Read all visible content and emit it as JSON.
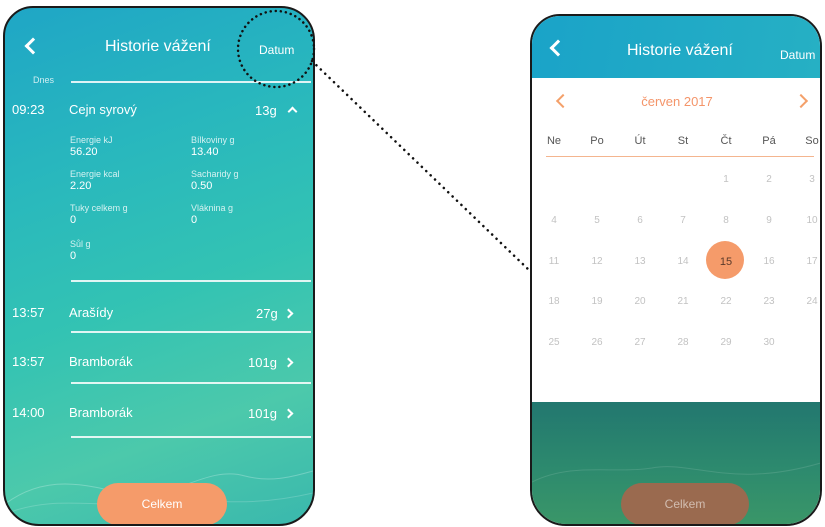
{
  "left": {
    "header": {
      "title": "Historie vážení",
      "date_button": "Datum"
    },
    "section_label": "Dnes",
    "entries": [
      {
        "time": "09:23",
        "name": "Cejn syrový",
        "amount": "13g",
        "expanded": true
      },
      {
        "time": "13:57",
        "name": "Arašídy",
        "amount": "27g",
        "expanded": false
      },
      {
        "time": "13:57",
        "name": "Bramborák",
        "amount": "101g",
        "expanded": false
      },
      {
        "time": "14:00",
        "name": "Bramborák",
        "amount": "101g",
        "expanded": false
      }
    ],
    "nutrition": [
      {
        "label": "Energie kJ",
        "value": "56.20"
      },
      {
        "label": "Bílkoviny g",
        "value": "13.40"
      },
      {
        "label": "Energie kcal",
        "value": "2.20"
      },
      {
        "label": "Sacharidy g",
        "value": "0.50"
      },
      {
        "label": "Tuky celkem g",
        "value": "0"
      },
      {
        "label": "Vláknina g",
        "value": "0"
      },
      {
        "label": "Sůl g",
        "value": "0"
      }
    ],
    "total_button": "Celkem"
  },
  "right": {
    "header": {
      "title": "Historie vážení",
      "date_button": "Datum"
    },
    "calendar": {
      "month": "červen 2017",
      "weekdays": [
        "Ne",
        "Po",
        "Út",
        "St",
        "Čt",
        "Pá",
        "So"
      ],
      "weeks": [
        [
          "",
          "",
          "",
          "",
          "1",
          "2",
          "3"
        ],
        [
          "4",
          "5",
          "6",
          "7",
          "8",
          "9",
          "10"
        ],
        [
          "11",
          "12",
          "13",
          "14",
          "15",
          "16",
          "17"
        ],
        [
          "18",
          "19",
          "20",
          "21",
          "22",
          "23",
          "24"
        ],
        [
          "25",
          "26",
          "27",
          "28",
          "29",
          "30",
          ""
        ]
      ],
      "selected_day": "15"
    },
    "total_button": "Celkem"
  },
  "colors": {
    "accent": "#f59b6a",
    "teal": "#26b0c4",
    "dark_green": "#2d8a6e"
  },
  "icons": {
    "back": "chevron-left-icon",
    "row_open": "chevron-right-icon",
    "row_collapse": "chevron-up-icon"
  }
}
